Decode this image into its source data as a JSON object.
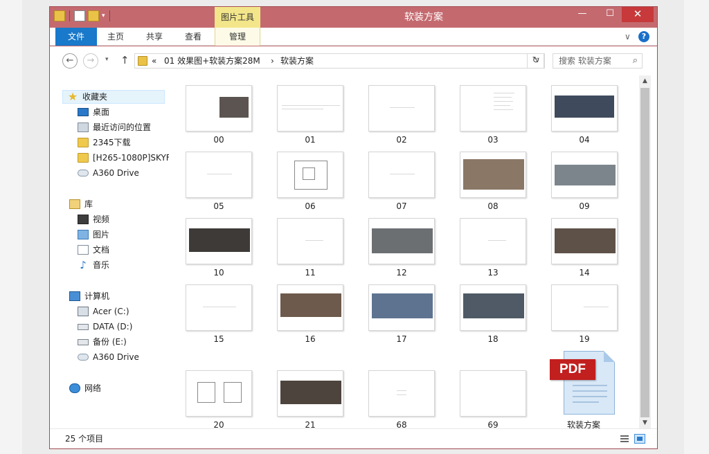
{
  "window": {
    "title": "软装方案",
    "context_tab": "图片工具",
    "minimize": "—",
    "maximize": "☐",
    "close": "✕",
    "dropdown": "▾"
  },
  "ribbon": {
    "tabs": [
      "文件",
      "主页",
      "共享",
      "查看",
      "管理"
    ],
    "expand": "∨",
    "help": "?"
  },
  "address": {
    "back": "←",
    "forward": "→",
    "recent": "▾",
    "up": "↑",
    "crumbs": [
      "«",
      "01 效果图+软装方案28M",
      "›",
      "软装方案"
    ],
    "dropdown": "∨",
    "refresh": "↻",
    "search_placeholder": "搜索 软装方案",
    "search_icon": "⌕"
  },
  "nav": {
    "favorites": {
      "label": "收藏夹",
      "icon": "star-icon",
      "items": [
        "桌面",
        "最近访问的位置",
        "2345下载",
        "[H265-1080P]SKYF",
        "A360 Drive"
      ]
    },
    "libraries": {
      "label": "库",
      "icon": "library-icon",
      "items": [
        "视频",
        "图片",
        "文档",
        "音乐"
      ]
    },
    "computer": {
      "label": "计算机",
      "icon": "computer-icon",
      "items": [
        "Acer (C:)",
        "DATA (D:)",
        "备份 (E:)",
        "A360 Drive"
      ]
    },
    "network": {
      "label": "网络",
      "icon": "network-icon"
    }
  },
  "files": [
    "00",
    "01",
    "02",
    "03",
    "04",
    "05",
    "06",
    "07",
    "08",
    "09",
    "10",
    "11",
    "12",
    "13",
    "14",
    "15",
    "16",
    "17",
    "18",
    "19",
    "20",
    "21",
    "68",
    "69"
  ],
  "pdf": {
    "badge": "PDF",
    "name": "软装方案"
  },
  "scroll": {
    "up": "▲",
    "down": "▼"
  },
  "status": {
    "count": "25 个项目"
  },
  "colors": {
    "frame": "#c46a6f",
    "file_tab": "#1979ca",
    "context_tab": "#f3e68a",
    "close": "#c7393a",
    "pdf_red": "#c21f1f"
  }
}
